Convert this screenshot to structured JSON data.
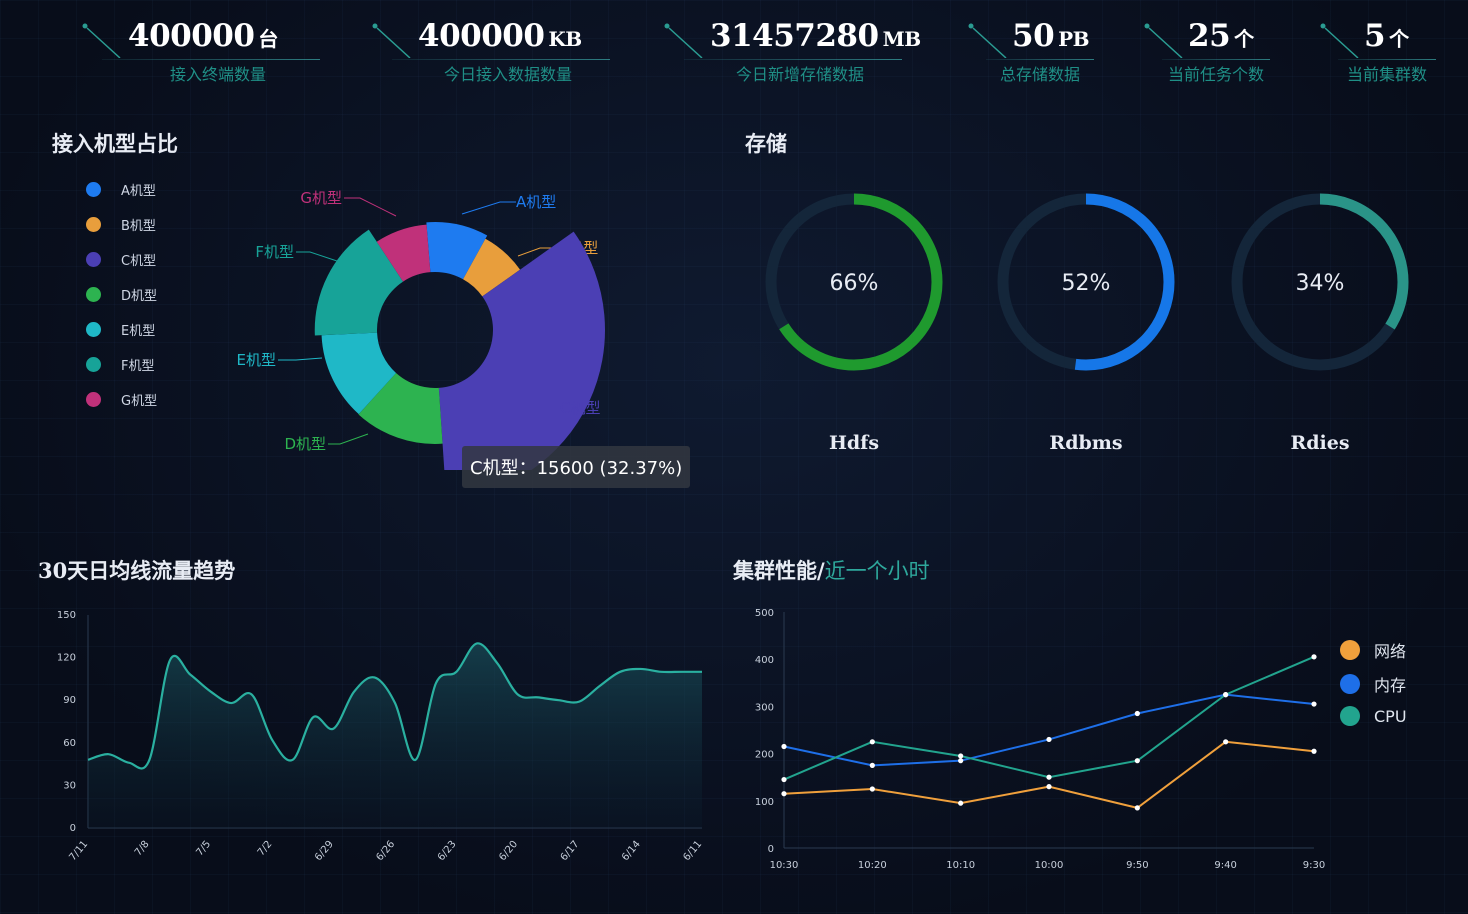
{
  "stats": [
    {
      "value": "400000",
      "unit": "台",
      "label": "接入终端数量"
    },
    {
      "value": "400000",
      "unit": "KB",
      "label": "今日接入数据数量"
    },
    {
      "value": "31457280",
      "unit": "MB",
      "label": "今日新增存储数据"
    },
    {
      "value": "50",
      "unit": "PB",
      "label": "总存储数据"
    },
    {
      "value": "25",
      "unit": "个",
      "label": "当前任务个数"
    },
    {
      "value": "5",
      "unit": "个",
      "label": "当前集群数"
    }
  ],
  "pie_section": {
    "title": "接入机型占比",
    "tooltip": "C机型：15600 (32.37%)"
  },
  "storage_section": {
    "title": "存储",
    "rings": [
      {
        "name": "Hdfs",
        "percent_text": "66%",
        "percent": 66,
        "color": "#1f9a2e"
      },
      {
        "name": "Rdbms",
        "percent_text": "52%",
        "percent": 52,
        "color": "#1677e8"
      },
      {
        "name": "Rdies",
        "percent_text": "34%",
        "percent": 34,
        "color": "#2a9488"
      }
    ]
  },
  "trend_section": {
    "title": "30天日均线流量趋势"
  },
  "perf_section": {
    "title": "集群性能/",
    "title_highlight": "近一个小时"
  },
  "chart_data": [
    {
      "type": "pie",
      "subtype": "rose-donut",
      "categories": [
        "A机型",
        "B机型",
        "C机型",
        "D机型",
        "E机型",
        "F机型",
        "G机型"
      ],
      "values": [
        4300,
        3300,
        15600,
        5900,
        5800,
        7600,
        3700
      ],
      "colors": [
        "#1e7bf0",
        "#e89e3c",
        "#4b3fb4",
        "#2db350",
        "#1fb8c7",
        "#17a398",
        "#c0317a"
      ],
      "legend": "left",
      "highlighted": "C机型"
    },
    {
      "type": "area",
      "categories": [
        "7/11",
        "7/8",
        "7/5",
        "7/2",
        "6/29",
        "6/26",
        "6/23",
        "6/20",
        "6/17",
        "6/14",
        "6/11"
      ],
      "x": [
        0,
        1,
        2,
        3,
        4,
        5,
        6,
        7,
        8,
        9,
        10,
        11,
        12,
        13,
        14,
        15,
        16,
        17,
        18,
        19,
        20,
        21,
        22,
        23,
        24,
        25,
        26,
        27,
        28,
        29,
        30
      ],
      "values": [
        48,
        52,
        46,
        48,
        118,
        108,
        96,
        88,
        94,
        62,
        48,
        78,
        70,
        96,
        106,
        88,
        48,
        102,
        110,
        130,
        116,
        94,
        92,
        90,
        89,
        100,
        110,
        112,
        110,
        110,
        110
      ],
      "ylim": [
        0,
        150
      ],
      "yticks": [
        0,
        30,
        60,
        90,
        120,
        150
      ],
      "color": "#2ab0a0",
      "grid": false
    },
    {
      "type": "line",
      "categories": [
        "10:30",
        "10:20",
        "10:10",
        "10:00",
        "9:50",
        "9:40",
        "9:30"
      ],
      "series": [
        {
          "name": "网络",
          "values": [
            115,
            125,
            95,
            130,
            85,
            225,
            205
          ],
          "color": "#f0a03c"
        },
        {
          "name": "内存",
          "values": [
            215,
            175,
            185,
            230,
            285,
            325,
            305
          ],
          "color": "#1e6fe8"
        },
        {
          "name": "CPU",
          "values": [
            145,
            225,
            195,
            150,
            185,
            325,
            405
          ],
          "color": "#22a48e"
        }
      ],
      "ylim": [
        0,
        500
      ],
      "yticks": [
        0,
        100,
        200,
        300,
        400,
        500
      ],
      "legend": "right",
      "grid": false
    }
  ]
}
